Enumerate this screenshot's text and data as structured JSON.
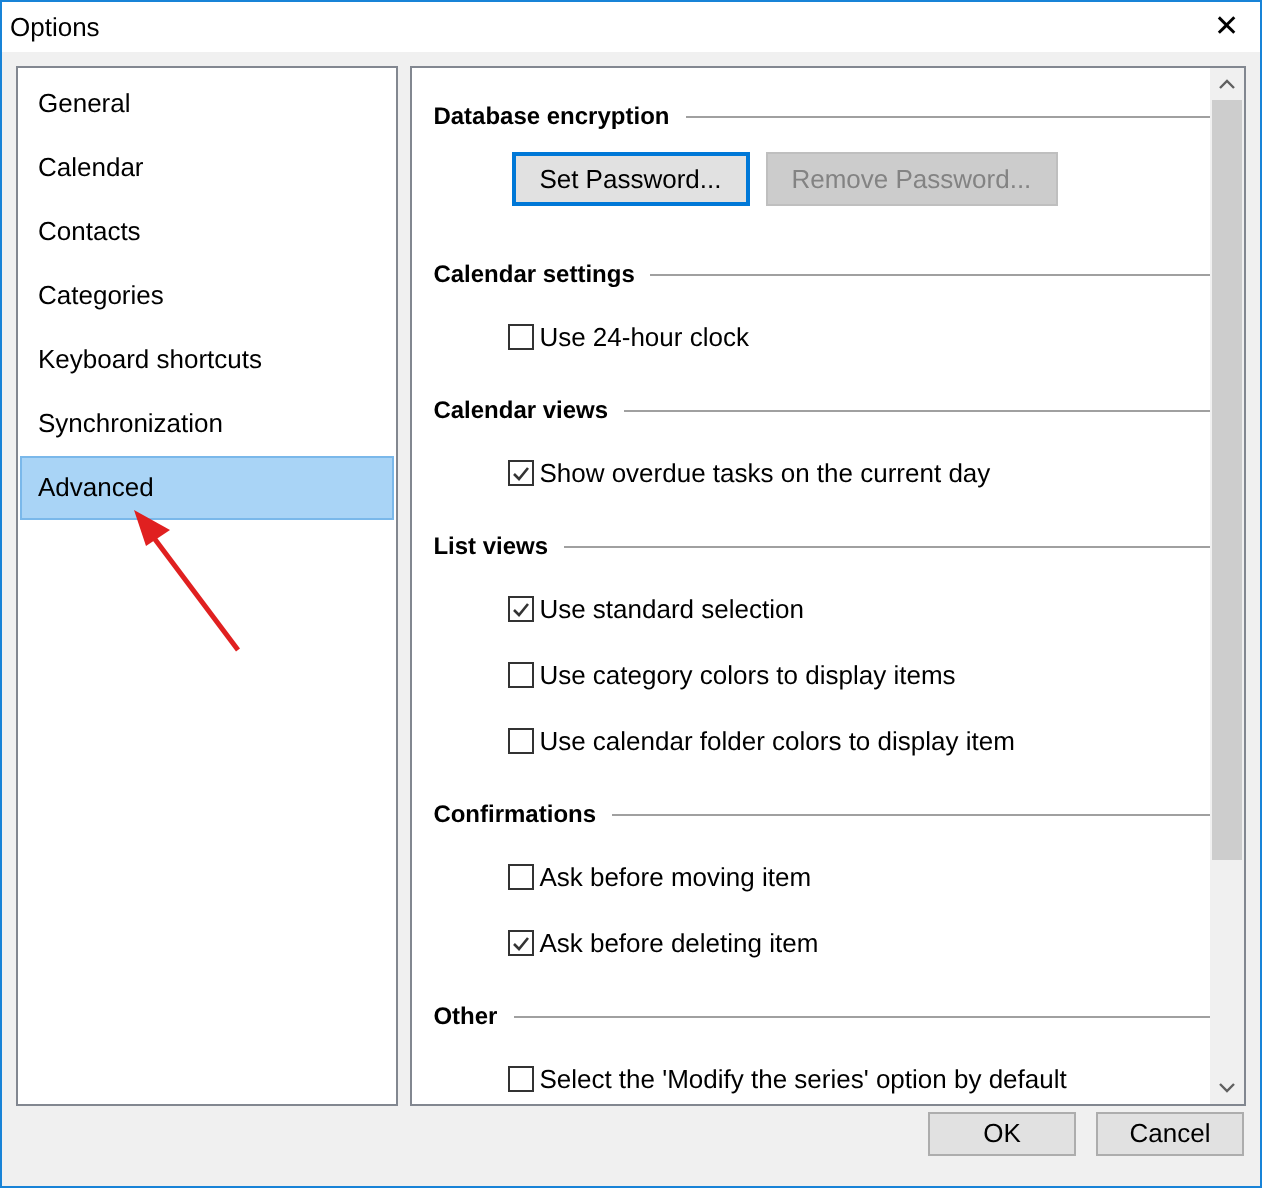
{
  "window": {
    "title": "Options",
    "close": "✕"
  },
  "sidebar": {
    "items": [
      {
        "label": "General",
        "selected": false
      },
      {
        "label": "Calendar",
        "selected": false
      },
      {
        "label": "Contacts",
        "selected": false
      },
      {
        "label": "Categories",
        "selected": false
      },
      {
        "label": "Keyboard shortcuts",
        "selected": false
      },
      {
        "label": "Synchronization",
        "selected": false
      },
      {
        "label": "Advanced",
        "selected": true
      }
    ]
  },
  "sections": [
    {
      "title": "Database encryption",
      "items": [
        {
          "kind": "button",
          "label": "Set Password...",
          "focused": true,
          "disabled": false
        },
        {
          "kind": "button",
          "label": "Remove Password...",
          "focused": false,
          "disabled": true
        }
      ]
    },
    {
      "title": "Calendar settings",
      "items": [
        {
          "kind": "checkbox",
          "label": "Use 24-hour clock",
          "checked": false
        }
      ]
    },
    {
      "title": "Calendar views",
      "items": [
        {
          "kind": "checkbox",
          "label": "Show overdue tasks on the current day",
          "checked": true
        }
      ]
    },
    {
      "title": "List views",
      "items": [
        {
          "kind": "checkbox",
          "label": "Use standard selection",
          "checked": true
        },
        {
          "kind": "checkbox",
          "label": "Use category colors to display items",
          "checked": false
        },
        {
          "kind": "checkbox",
          "label": "Use calendar folder colors to display item",
          "checked": false
        }
      ]
    },
    {
      "title": "Confirmations",
      "items": [
        {
          "kind": "checkbox",
          "label": "Ask before moving item",
          "checked": false
        },
        {
          "kind": "checkbox",
          "label": "Ask before deleting item",
          "checked": true
        }
      ]
    },
    {
      "title": "Other",
      "items": [
        {
          "kind": "checkbox",
          "label": "Select the 'Modify the series' option by default",
          "checked": false
        }
      ]
    }
  ],
  "footer": {
    "buttons": [
      "OK",
      "Cancel"
    ]
  }
}
